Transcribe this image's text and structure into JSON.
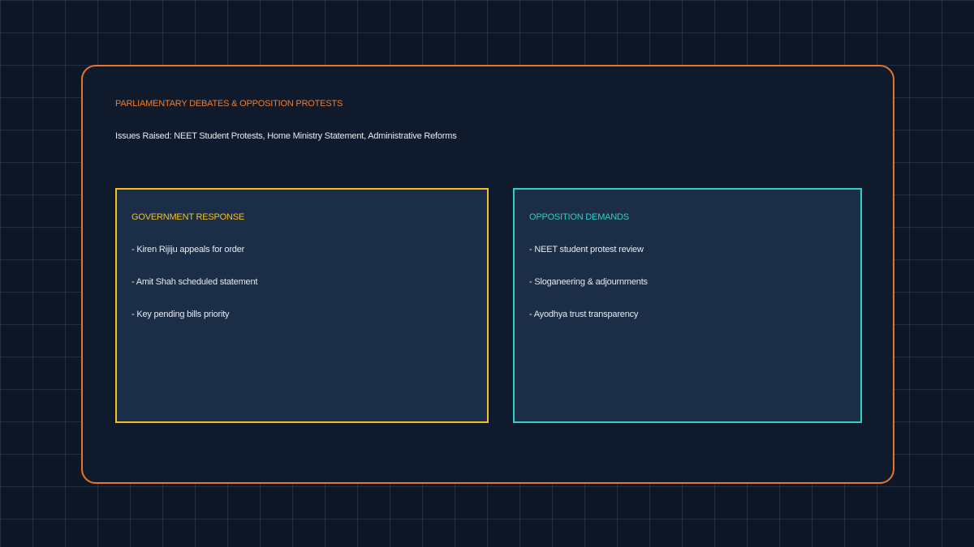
{
  "panel": {
    "title": "PARLIAMENTARY DEBATES & OPPOSITION PROTESTS",
    "subtitle": "Issues Raised: NEET Student Protests, Home Ministry Statement, Administrative Reforms"
  },
  "cards": {
    "government": {
      "title": "GOVERNMENT RESPONSE",
      "items": [
        "- Kiren Rijiju appeals for order",
        "- Amit Shah scheduled statement",
        "- Key pending bills priority"
      ]
    },
    "opposition": {
      "title": "OPPOSITION DEMANDS",
      "items": [
        "- NEET student protest review",
        "- Sloganeering & adjournments",
        "- Ayodhya trust transparency"
      ]
    }
  },
  "colors": {
    "background": "#0d1726",
    "grid": "#2e4462",
    "panel": "#0f1b2d",
    "panel_border": "#e8742a",
    "card": "#1c2e47",
    "government_accent": "#f4c025",
    "opposition_accent": "#2ed1c4",
    "text": "#e6ebf2"
  }
}
